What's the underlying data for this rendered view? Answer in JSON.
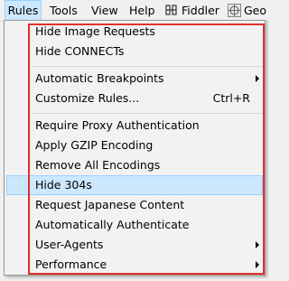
{
  "menubar": {
    "items": [
      {
        "label": "Rules"
      },
      {
        "label": "Tools"
      },
      {
        "label": "View"
      },
      {
        "label": "Help"
      },
      {
        "label": "Fiddler"
      },
      {
        "label": "Geo"
      }
    ]
  },
  "rules_menu": {
    "items": [
      {
        "label": "Hide Image Requests"
      },
      {
        "label": "Hide CONNECTs"
      },
      {
        "label": "Automatic Breakpoints",
        "submenu": true
      },
      {
        "label": "Customize Rules...",
        "shortcut": "Ctrl+R"
      },
      {
        "label": "Require Proxy Authentication"
      },
      {
        "label": "Apply GZIP Encoding"
      },
      {
        "label": "Remove All Encodings"
      },
      {
        "label": "Hide 304s"
      },
      {
        "label": "Request Japanese Content"
      },
      {
        "label": "Automatically Authenticate"
      },
      {
        "label": "User-Agents",
        "submenu": true
      },
      {
        "label": "Performance",
        "submenu": true
      }
    ]
  },
  "colors": {
    "active_bg": "#cce8ff",
    "active_border": "#99d1ff",
    "annotation_border": "#e0322f",
    "menu_bg": "#f2f2f2"
  }
}
